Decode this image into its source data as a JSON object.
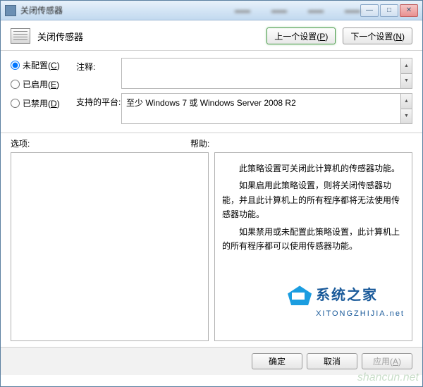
{
  "window": {
    "title": "关闭传感器",
    "min": "—",
    "max": "□",
    "close": "✕"
  },
  "header": {
    "title": "关闭传感器",
    "prev_btn": "上一个设置",
    "prev_key": "P",
    "next_btn": "下一个设置",
    "next_key": "N"
  },
  "radios": {
    "not_configured": {
      "label": "未配置",
      "key": "C"
    },
    "enabled": {
      "label": "已启用",
      "key": "E"
    },
    "disabled": {
      "label": "已禁用",
      "key": "D"
    }
  },
  "fields": {
    "comment_label": "注释:",
    "comment_value": "",
    "platform_label": "支持的平台:",
    "platform_value": "至少 Windows 7 或 Windows Server 2008 R2"
  },
  "panels": {
    "options_label": "选项:",
    "help_label": "帮助:",
    "help_text": {
      "p1": "此策略设置可关闭此计算机的传感器功能。",
      "p2": "如果启用此策略设置，则将关闭传感器功能，并且此计算机上的所有程序都将无法使用传感器功能。",
      "p3": "如果禁用或未配置此策略设置，此计算机上的所有程序都可以使用传感器功能。"
    }
  },
  "footer": {
    "ok": "确定",
    "cancel": "取消",
    "apply": "应用",
    "apply_key": "A"
  },
  "watermark": {
    "cn": "系统之家",
    "url": "XITONGZHIJIA.net",
    "corner": "shancun.net"
  }
}
